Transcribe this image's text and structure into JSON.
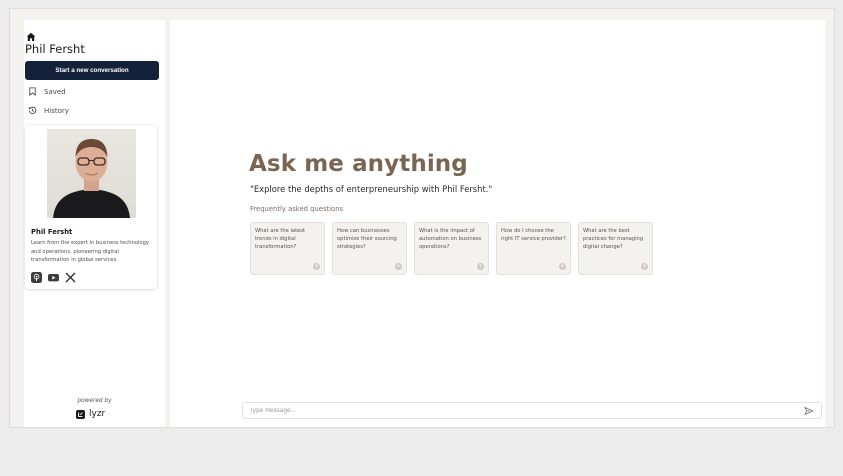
{
  "sidebar": {
    "brand_name": "Phil Fersht",
    "new_conversation_label": "Start a new conversation",
    "nav": {
      "saved": "Saved",
      "history": "History"
    },
    "profile": {
      "name": "Phil Fersht",
      "description": "Learn from the expert in business technology and operations, pioneering digital transformation in global services.",
      "social_icons": [
        "podcast-icon",
        "youtube-icon",
        "x-icon"
      ]
    },
    "powered_by": "powered by",
    "lyzr_label": "lyzr"
  },
  "main": {
    "title": "Ask me anything",
    "subtitle": "\"Explore the depths of enterpreneurship with Phil Fersht.\"",
    "faq_label": "Frequently asked questions",
    "faqs": [
      "What are the latest trends in digital transformation?",
      "How can businesses optimize their sourcing strategies?",
      "What is the impact of automation on business operations?",
      "How do I choose the right IT service provider?",
      "What are the best practices for managing digital change?"
    ],
    "message_placeholder": "Type Message..."
  },
  "colors": {
    "accent_button": "#14213a",
    "title_color": "#7a6553",
    "card_bg": "#f4f2ee"
  }
}
